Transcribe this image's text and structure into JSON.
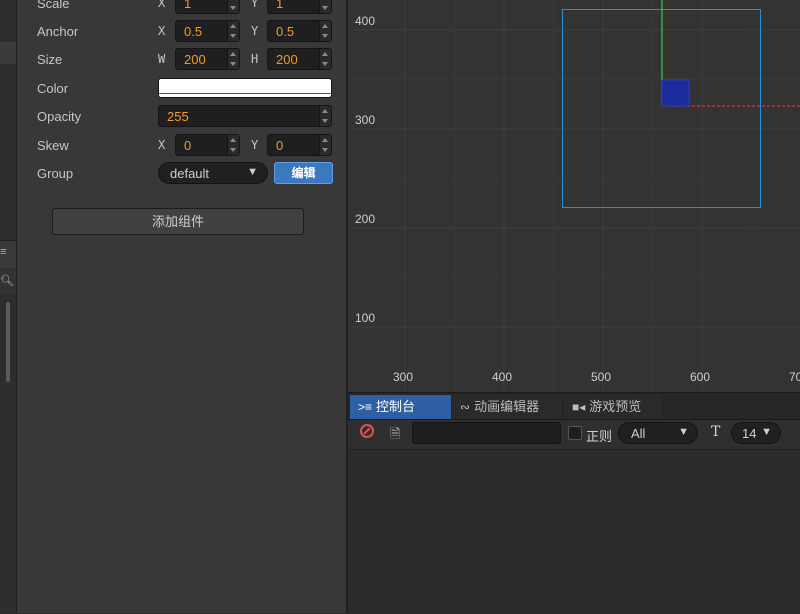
{
  "inspector": {
    "scale": {
      "label": "Scale",
      "x_axis": "X",
      "x_value": "1",
      "y_axis": "Y",
      "y_value": "1"
    },
    "anchor": {
      "label": "Anchor",
      "x_axis": "X",
      "x_value": "0.5",
      "y_axis": "Y",
      "y_value": "0.5"
    },
    "size": {
      "label": "Size",
      "w_axis": "W",
      "w_value": "200",
      "h_axis": "H",
      "h_value": "200"
    },
    "color": {
      "label": "Color",
      "value": "#ffffff"
    },
    "opacity": {
      "label": "Opacity",
      "value": "255"
    },
    "skew": {
      "label": "Skew",
      "x_axis": "X",
      "x_value": "0",
      "y_axis": "Y",
      "y_value": "0"
    },
    "group": {
      "label": "Group",
      "value": "default",
      "edit_label": "编辑"
    },
    "add_component_label": "添加组件"
  },
  "scene": {
    "y_labels": [
      "400",
      "300",
      "200",
      "100"
    ],
    "x_labels": [
      "300",
      "400",
      "500",
      "600",
      "70"
    ],
    "colors": {
      "node_rect": "#1f8fe0",
      "node_fill": "#1d2a9a",
      "y_axis": "#3fcf3f",
      "x_axis": "#e03030"
    }
  },
  "console": {
    "tabs": [
      {
        "label": "控制台",
        "icon": "terminal-icon"
      },
      {
        "label": "动画编辑器",
        "icon": "animation-icon"
      },
      {
        "label": "游戏预览",
        "icon": "camera-icon"
      }
    ],
    "regex_label": "正则",
    "level_value": "All",
    "font_size_value": "14"
  }
}
